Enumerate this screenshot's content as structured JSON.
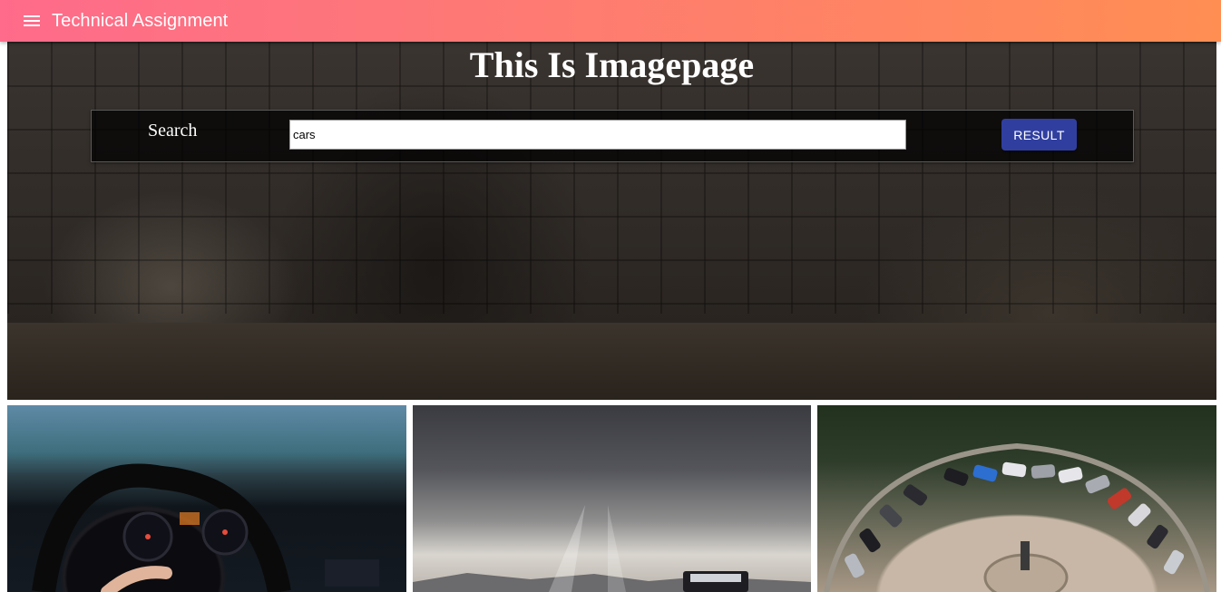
{
  "appbar": {
    "title": "Technical Assignment",
    "menu_icon": "menu-icon",
    "gradient_from": "#fe6b8b",
    "gradient_to": "#ff8e53"
  },
  "hero": {
    "title": "This Is Imagepage"
  },
  "search": {
    "label": "Search",
    "value": "cars",
    "button_label": "RESULT",
    "button_color": "#303f9f"
  },
  "images": [
    {
      "name": "car-dashboard-image"
    },
    {
      "name": "car-on-road-image"
    },
    {
      "name": "parking-lot-aerial-image"
    }
  ]
}
